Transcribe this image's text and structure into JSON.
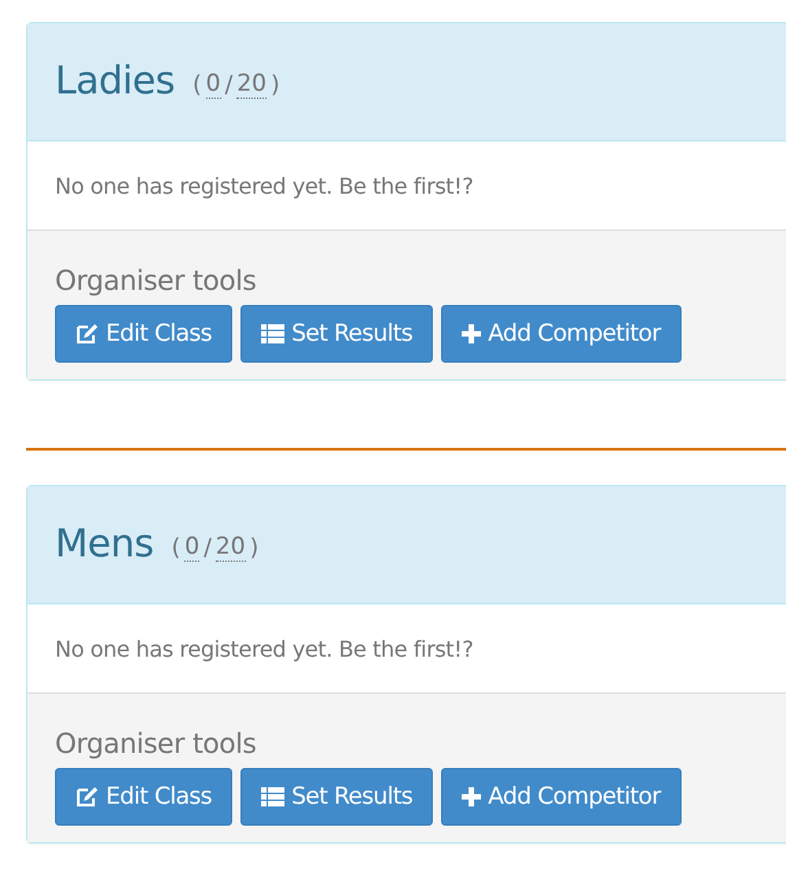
{
  "classes": [
    {
      "title": "Ladies",
      "prefix": "(",
      "count": "0",
      "separator": "/",
      "capacity": "20",
      "suffix": ")",
      "empty_message": "No one has registered yet. Be the first!?",
      "tools_title": "Organiser tools",
      "buttons": [
        {
          "kind": "edit",
          "label": "Edit Class"
        },
        {
          "kind": "list",
          "label": "Set Results"
        },
        {
          "kind": "plus",
          "label": "Add Competitor"
        }
      ]
    },
    {
      "title": "Mens",
      "prefix": "(",
      "count": "0",
      "separator": "/",
      "capacity": "20",
      "suffix": ")",
      "empty_message": "No one has registered yet. Be the first!?",
      "tools_title": "Organiser tools",
      "buttons": [
        {
          "kind": "edit",
          "label": "Edit Class"
        },
        {
          "kind": "list",
          "label": "Set Results"
        },
        {
          "kind": "plus",
          "label": "Add Competitor"
        }
      ]
    }
  ]
}
